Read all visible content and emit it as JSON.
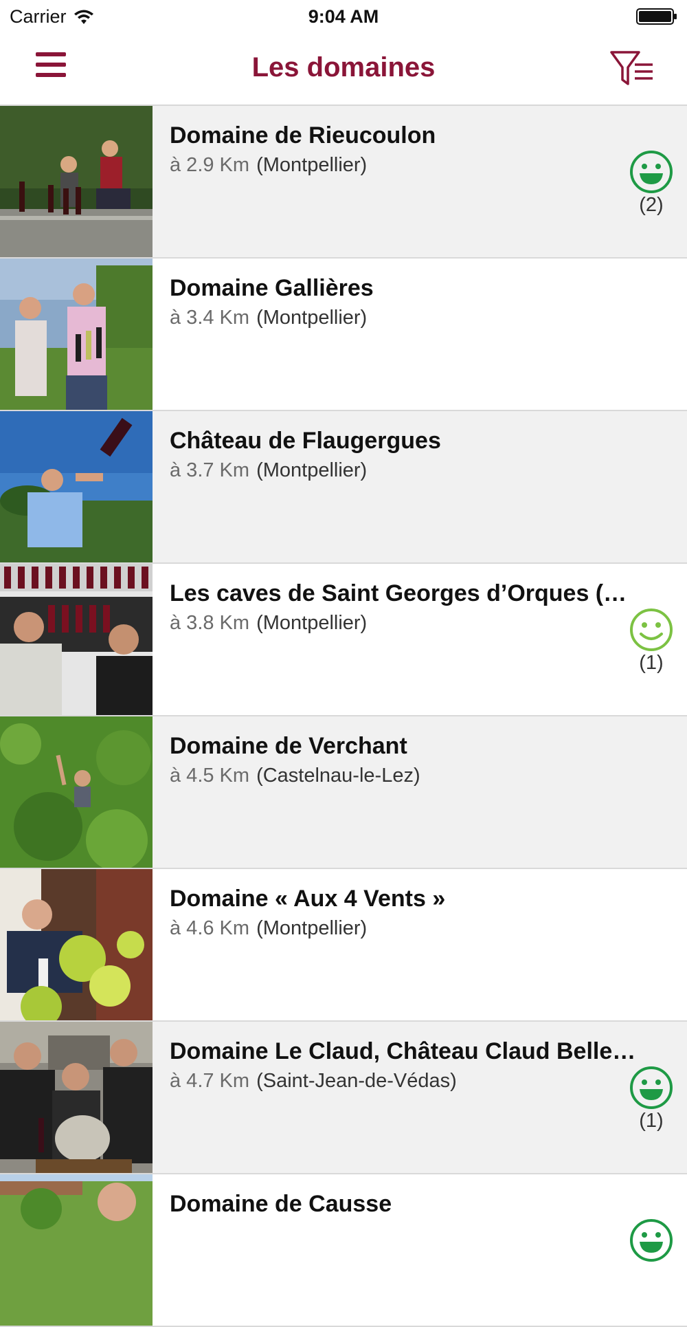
{
  "status_bar": {
    "carrier": "Carrier",
    "time": "9:04 AM"
  },
  "nav": {
    "title": "Les domaines",
    "menu_icon": "hamburger-menu-icon",
    "filter_icon": "filter-list-icon"
  },
  "colors": {
    "brand": "#8a1538",
    "rating_green_dark": "#1e9a45",
    "rating_green_light": "#7cc243",
    "row_shaded": "#f1f1f1"
  },
  "domaines": [
    {
      "name": "Domaine de Rieucoulon",
      "distance": "à 2.9 Km",
      "city": "(Montpellier)",
      "rating": "grin",
      "rating_count": "(2)"
    },
    {
      "name": "Domaine Gallières",
      "distance": "à 3.4 Km",
      "city": "(Montpellier)",
      "rating": null,
      "rating_count": null
    },
    {
      "name": "Château de Flaugergues",
      "distance": "à 3.7 Km",
      "city": "(Montpellier)",
      "rating": null,
      "rating_count": null
    },
    {
      "name": "Les caves de Saint Georges d’Orques (…",
      "distance": "à 3.8 Km",
      "city": "(Montpellier)",
      "rating": "smile",
      "rating_count": "(1)"
    },
    {
      "name": "Domaine de Verchant",
      "distance": "à 4.5 Km",
      "city": "(Castelnau-le-Lez)",
      "rating": null,
      "rating_count": null
    },
    {
      "name": "Domaine « Aux 4 Vents »",
      "distance": "à 4.6 Km",
      "city": "(Montpellier)",
      "rating": null,
      "rating_count": null
    },
    {
      "name": "Domaine Le Claud, Château Claud Belle…",
      "distance": "à 4.7 Km",
      "city": "(Saint-Jean-de-Védas)",
      "rating": "grin",
      "rating_count": "(1)"
    },
    {
      "name": "Domaine de Causse",
      "distance": "",
      "city": "",
      "rating": "grin",
      "rating_count": ""
    }
  ]
}
